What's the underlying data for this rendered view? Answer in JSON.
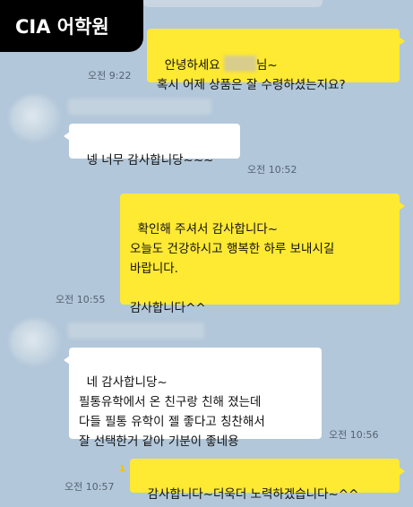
{
  "watermark": {
    "text": "CIA 어학원"
  },
  "messages": [
    {
      "id": 1,
      "side": "out",
      "line1_before": "안녕하세요 ",
      "line1_after": "님~",
      "line2": "혹시 어제 상품은 잘 수령하셨는지요?",
      "time": "오전 9:22"
    },
    {
      "id": 2,
      "side": "in",
      "text": "넹 너무 감사합니당~~~",
      "time": "오전 10:52"
    },
    {
      "id": 3,
      "side": "out",
      "text": "확인해 주셔서 감사합니다~\n오늘도 건강하시고 행복한 하루 보내시길\n바랍니다.\n\n감사합니다^^",
      "time": "오전 10:55"
    },
    {
      "id": 4,
      "side": "in",
      "text": "네 감사합니당~\n필통유학에서 온 친구랑 친해 졌는데\n다들 필통 유학이 젤 좋다고 칭찬해서\n잘 선택한거 같아 기분이 좋네용",
      "time": "오전 10:56"
    },
    {
      "id": 5,
      "side": "out",
      "text": "감사합니다~더욱더 노력하겠습니다~^^",
      "time": "오전 10:57",
      "unread": "1"
    }
  ]
}
